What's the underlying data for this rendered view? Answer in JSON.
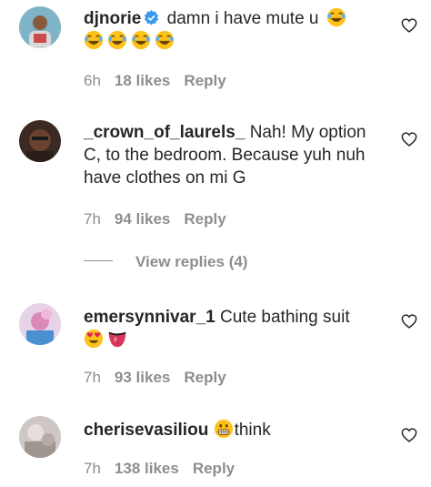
{
  "comments": [
    {
      "username": "djnorie",
      "verified": true,
      "text": "damn i have mute u",
      "emojis": [
        "joy",
        "joy",
        "joy",
        "joy",
        "joy"
      ],
      "time": "6h",
      "likes": "18 likes",
      "reply": "Reply"
    },
    {
      "username": "_crown_of_laurels_",
      "verified": false,
      "text": "Nah! My option C, to the bedroom. Because yuh nuh have clothes on mi G",
      "time": "7h",
      "likes": "94 likes",
      "reply": "Reply",
      "view_replies": "View replies (4)"
    },
    {
      "username": "emersynnivar_1",
      "verified": false,
      "text": "Cute bathing suit",
      "emojis": [
        "heart-eyes",
        "tongue"
      ],
      "time": "7h",
      "likes": "93 likes",
      "reply": "Reply"
    },
    {
      "username": "cherisevasiliou",
      "verified": false,
      "text": "think",
      "emojis": [
        "grimace"
      ],
      "time": "7h",
      "likes": "138 likes",
      "reply": "Reply"
    }
  ],
  "colors": {
    "text": "#262626",
    "secondary": "#8e8e8e",
    "verified": "#3897f0",
    "emoji": "#fcc21b"
  }
}
